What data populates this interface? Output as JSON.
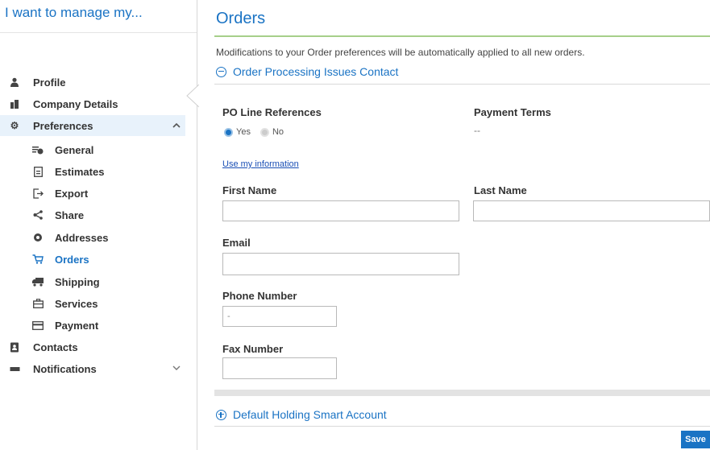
{
  "sidebar": {
    "title": "I want to manage my...",
    "items": [
      {
        "label": "Profile",
        "icon": "person-icon"
      },
      {
        "label": "Company Details",
        "icon": "building-icon"
      },
      {
        "label": "Preferences",
        "icon": "gear-icon"
      },
      {
        "label": "General",
        "icon": "general-settings-icon"
      },
      {
        "label": "Estimates",
        "icon": "estimate-doc-icon"
      },
      {
        "label": "Export",
        "icon": "export-icon"
      },
      {
        "label": "Share",
        "icon": "share-icon"
      },
      {
        "label": "Addresses",
        "icon": "location-icon"
      },
      {
        "label": "Orders",
        "icon": "cart-icon"
      },
      {
        "label": "Shipping",
        "icon": "truck-icon"
      },
      {
        "label": "Services",
        "icon": "briefcase-icon"
      },
      {
        "label": "Payment",
        "icon": "card-icon"
      },
      {
        "label": "Contacts",
        "icon": "address-book-icon"
      },
      {
        "label": "Notifications",
        "icon": "chat-icon"
      }
    ]
  },
  "main": {
    "title": "Orders",
    "intro": "Modifications to your Order preferences will be automatically applied to all new orders.",
    "section1": "Order Processing Issues Contact",
    "po_label": "PO Line References",
    "po_yes": "Yes",
    "po_no": "No",
    "terms_label": "Payment Terms",
    "terms_value": "--",
    "use_info": "Use my information",
    "first_name_label": "First Name",
    "last_name_label": "Last Name",
    "email_label": "Email",
    "phone_label": "Phone Number",
    "phone_value": "-",
    "fax_label": "Fax Number",
    "section2": "Default Holding Smart Account",
    "save": "Save"
  },
  "colors": {
    "accent": "#1a73c4",
    "title_rule": "#a6cf8a"
  }
}
